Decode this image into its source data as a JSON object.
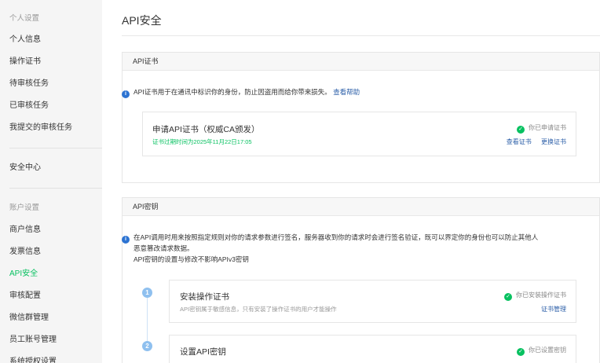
{
  "sidebar": {
    "groups": [
      {
        "title": "个人设置",
        "items": [
          "个人信息",
          "操作证书",
          "待审核任务",
          "已审核任务",
          "我提交的审核任务"
        ]
      },
      {
        "title": "",
        "items": [
          "安全中心"
        ]
      },
      {
        "title": "账户设置",
        "items": [
          "商户信息",
          "发票信息",
          "API安全",
          "审核配置",
          "微信群管理",
          "员工账号管理",
          "系统授权设置"
        ]
      }
    ],
    "active_item": "API安全"
  },
  "main": {
    "page_title": "API安全",
    "cert_section": {
      "header": "API证书",
      "info_text": "API证书用于在通讯中标识你的身份，防止因盗用而给你带来损失。",
      "info_link": "查看帮助",
      "card": {
        "title": "申请API证书（权威CA颁发）",
        "expiry": "证书过期时间为2025年11月22日17:05",
        "status": "你已申请证书",
        "actions": [
          "查看证书",
          "更换证书"
        ]
      }
    },
    "key_section": {
      "header": "API密钥",
      "info_line1": "在API调用时用来按照指定规则对你的请求参数进行签名，服务器收到你的请求时会进行签名验证，既可以界定你的身份也可以防止其他人",
      "info_line2": "恶意篡改请求数据。",
      "info_line3": "API密钥的设置与修改不影响APIv3密钥",
      "steps": [
        {
          "number": "1",
          "title": "安装操作证书",
          "desc": "API密钥属于敏感信息，只有安装了操作证书的用户才能操作",
          "status": "你已安装操作证书",
          "action": "证书管理"
        },
        {
          "number": "2",
          "title": "设置API密钥",
          "desc": "",
          "status": "你已设置密钥",
          "action": ""
        }
      ]
    }
  },
  "colors": {
    "accent_green": "#07c160",
    "link_blue": "#2c5fa8",
    "info_blue": "#2c73d2"
  }
}
